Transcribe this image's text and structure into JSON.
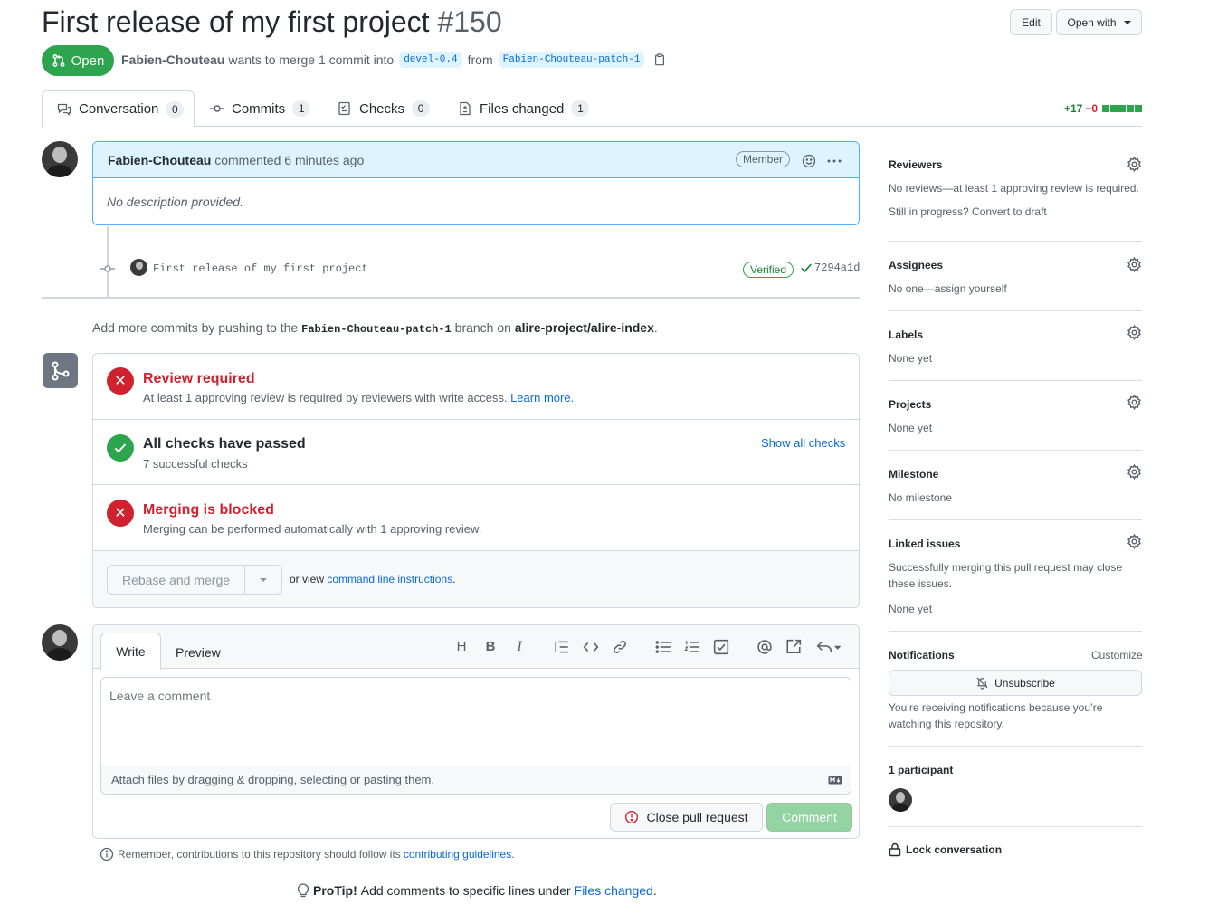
{
  "pr": {
    "title": "First release of my first project",
    "number": "#150",
    "state": "Open",
    "author": "Fabien-Chouteau",
    "merge_text": "wants to merge 1 commit into",
    "base_branch": "devel-0.4",
    "from_text": "from",
    "head_branch": "Fabien-Chouteau-patch-1"
  },
  "header_buttons": {
    "edit": "Edit",
    "open_with": "Open with"
  },
  "tabs": [
    {
      "label": "Conversation",
      "count": "0"
    },
    {
      "label": "Commits",
      "count": "1"
    },
    {
      "label": "Checks",
      "count": "0"
    },
    {
      "label": "Files changed",
      "count": "1"
    }
  ],
  "diffstat": {
    "additions": "+17",
    "deletions": "−0"
  },
  "comment": {
    "author": "Fabien-Chouteau",
    "action": "commented",
    "time": "6 minutes ago",
    "badge": "Member",
    "body": "No description provided."
  },
  "commit": {
    "message": "First release of my first project",
    "verified": "Verified",
    "sha": "7294a1d"
  },
  "push_hint": {
    "prefix": "Add more commits by pushing to the",
    "branch": "Fabien-Chouteau-patch-1",
    "middle": "branch on",
    "repo": "alire-project/alire-index",
    "suffix": "."
  },
  "merge_box": {
    "review": {
      "title": "Review required",
      "text": "At least 1 approving review is required by reviewers with write access.",
      "link": "Learn more."
    },
    "checks": {
      "title": "All checks have passed",
      "text": "7 successful checks",
      "link": "Show all checks"
    },
    "blocked": {
      "title": "Merging is blocked",
      "text": "Merging can be performed automatically with 1 approving review."
    },
    "merge_button": "Rebase and merge",
    "or_view": "or view",
    "cli_link": "command line instructions",
    "cli_suffix": "."
  },
  "editor": {
    "tab_write": "Write",
    "tab_preview": "Preview",
    "placeholder": "Leave a comment",
    "attach": "Attach files by dragging & dropping, selecting or pasting them.",
    "close_pr": "Close pull request",
    "comment": "Comment"
  },
  "guidelines": {
    "prefix": "Remember, contributions to this repository should follow its",
    "link": "contributing guidelines",
    "suffix": "."
  },
  "protip": {
    "bold": "ProTip!",
    "text": "Add comments to specific lines under",
    "link": "Files changed",
    "suffix": "."
  },
  "sidebar": {
    "reviewers": {
      "title": "Reviewers",
      "text": "No reviews—at least 1 approving review is required.",
      "draft": "Still in progress? Convert to draft"
    },
    "assignees": {
      "title": "Assignees",
      "text": "No one—assign yourself"
    },
    "labels": {
      "title": "Labels",
      "text": "None yet"
    },
    "projects": {
      "title": "Projects",
      "text": "None yet"
    },
    "milestone": {
      "title": "Milestone",
      "text": "No milestone"
    },
    "linked": {
      "title": "Linked issues",
      "text": "Successfully merging this pull request may close these issues.",
      "none": "None yet"
    },
    "notifications": {
      "title": "Notifications",
      "customize": "Customize",
      "button": "Unsubscribe",
      "text": "You’re receiving notifications because you’re watching this repository."
    },
    "participants": {
      "title": "1 participant"
    },
    "lock": "Lock conversation"
  },
  "colors": {
    "open_green": "#2da44e",
    "danger": "#cf222e",
    "link": "#0969da"
  }
}
